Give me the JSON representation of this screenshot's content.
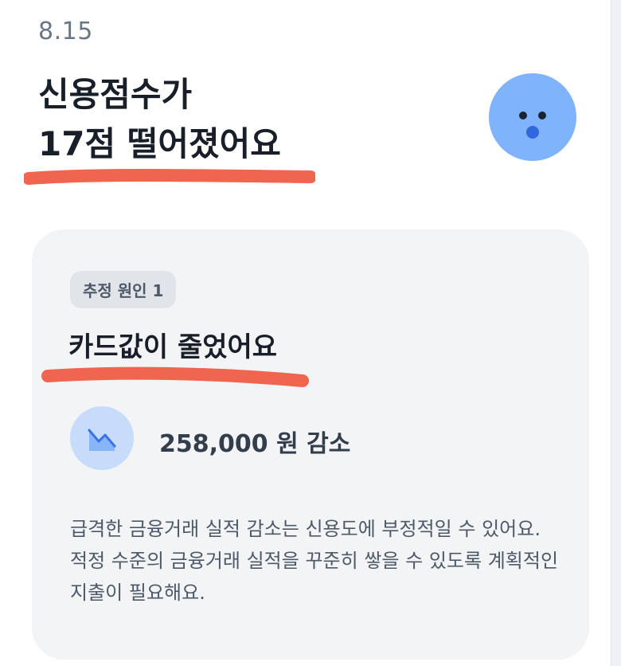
{
  "date": "8.15",
  "headline": {
    "line1": "신용점수가",
    "line2": "17점 떨어졌어요"
  },
  "annotation_color": "#f0654f",
  "avatar_color": "#7fb3fb",
  "card": {
    "badge": "추정 원인 1",
    "reason": "카드값이 줄었어요",
    "stat_icon": "trend-down-icon",
    "stat_value": "258,000 원 감소",
    "description": "급격한 금융거래 실적 감소는 신용도에 부정적일 수 있어요. 적정 수준의 금융거래 실적을 꾸준히 쌓을 수 있도록 계획적인 지출이 필요해요."
  }
}
